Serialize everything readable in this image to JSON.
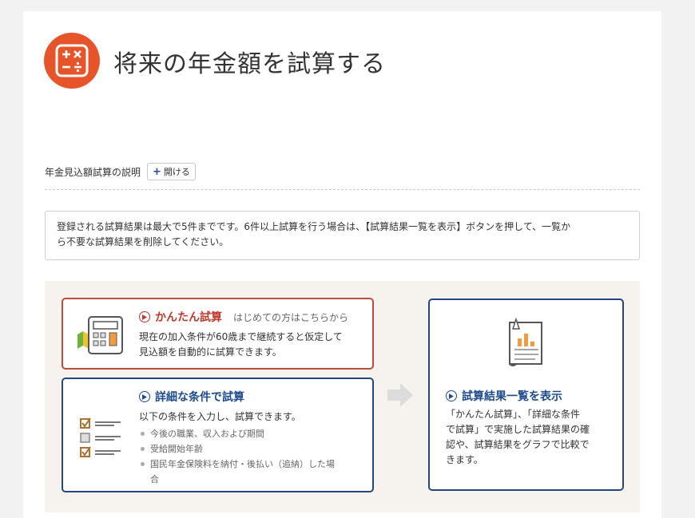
{
  "header": {
    "icon": "calculator-symbols-icon",
    "title": "将来の年金額を試算する"
  },
  "explain": {
    "label": "年金見込額試算の説明",
    "open_button": "開ける"
  },
  "notice": {
    "line1": "登録される試算結果は最大で5件までです。6件以上試算を行う場合は、【試算結果一覧を表示】ボタンを押して、一覧か",
    "line2": "ら不要な試算結果を削除してください。"
  },
  "easy": {
    "title": "かんたん試算",
    "subtitle": "はじめての方はこちらから",
    "desc_line1": "現在の加入条件が60歳まで継続すると仮定して",
    "desc_line2": "見込額を自動的に試算できます。"
  },
  "detail": {
    "title": "詳細な条件で試算",
    "desc": "以下の条件を入力し、試算できます。",
    "bullets": [
      "今後の職業、収入および期間",
      "受給開始年齢",
      "国民年金保険料を納付・後払い（追納）した場"
    ],
    "bullet_cont": "合"
  },
  "list": {
    "title": "試算結果一覧を表示",
    "desc_lines": [
      "「かんたん試算」、「詳細な条件",
      "で試算」で実施した試算結果の確",
      "認や、試算結果をグラフで比較で",
      "きます。"
    ]
  },
  "colors": {
    "accent_orange": "#e8542a",
    "easy_red": "#c14a3e",
    "navy": "#23467f"
  }
}
